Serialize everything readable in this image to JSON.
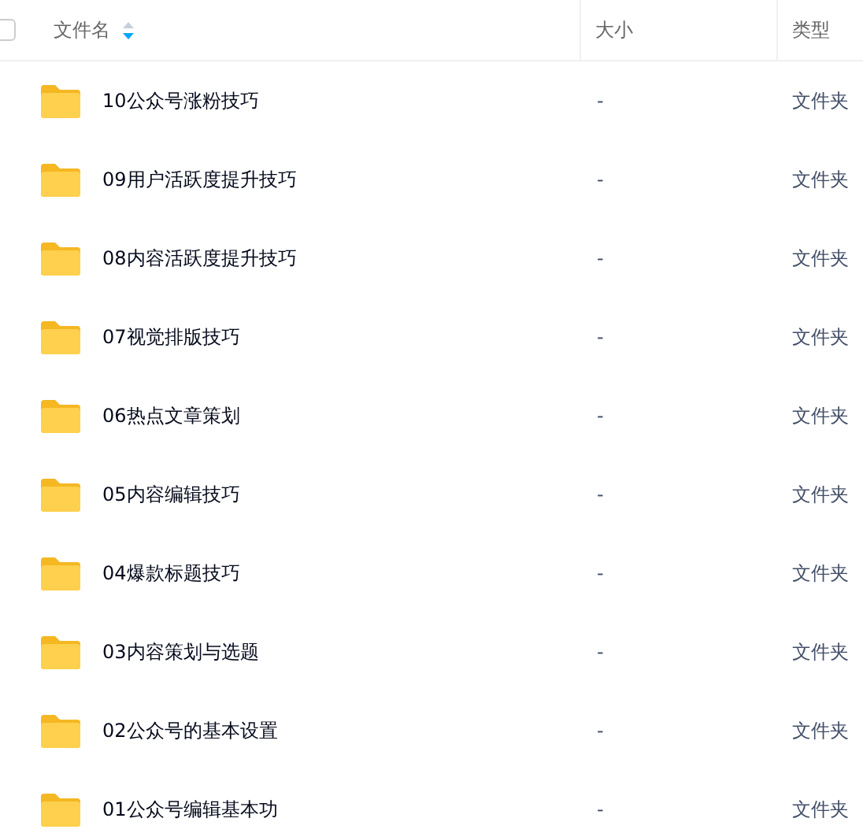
{
  "table": {
    "select_all": {
      "checked": false
    },
    "columns": [
      {
        "label": "文件名",
        "sort_descending": true
      },
      {
        "label": "大小"
      },
      {
        "label": "类型"
      }
    ],
    "rows": [
      {
        "name": "10公众号涨粉技巧",
        "size": "-",
        "type": "文件夹"
      },
      {
        "name": "09用户活跃度提升技巧",
        "size": "-",
        "type": "文件夹"
      },
      {
        "name": "08内容活跃度提升技巧",
        "size": "-",
        "type": "文件夹"
      },
      {
        "name": "07视觉排版技巧",
        "size": "-",
        "type": "文件夹"
      },
      {
        "name": "06热点文章策划",
        "size": "-",
        "type": "文件夹"
      },
      {
        "name": "05内容编辑技巧",
        "size": "-",
        "type": "文件夹"
      },
      {
        "name": "04爆款标题技巧",
        "size": "-",
        "type": "文件夹"
      },
      {
        "name": "03内容策划与选题",
        "size": "-",
        "type": "文件夹"
      },
      {
        "name": "02公众号的基本设置",
        "size": "-",
        "type": "文件夹"
      },
      {
        "name": "01公众号编辑基本功",
        "size": "-",
        "type": "文件夹"
      }
    ]
  }
}
